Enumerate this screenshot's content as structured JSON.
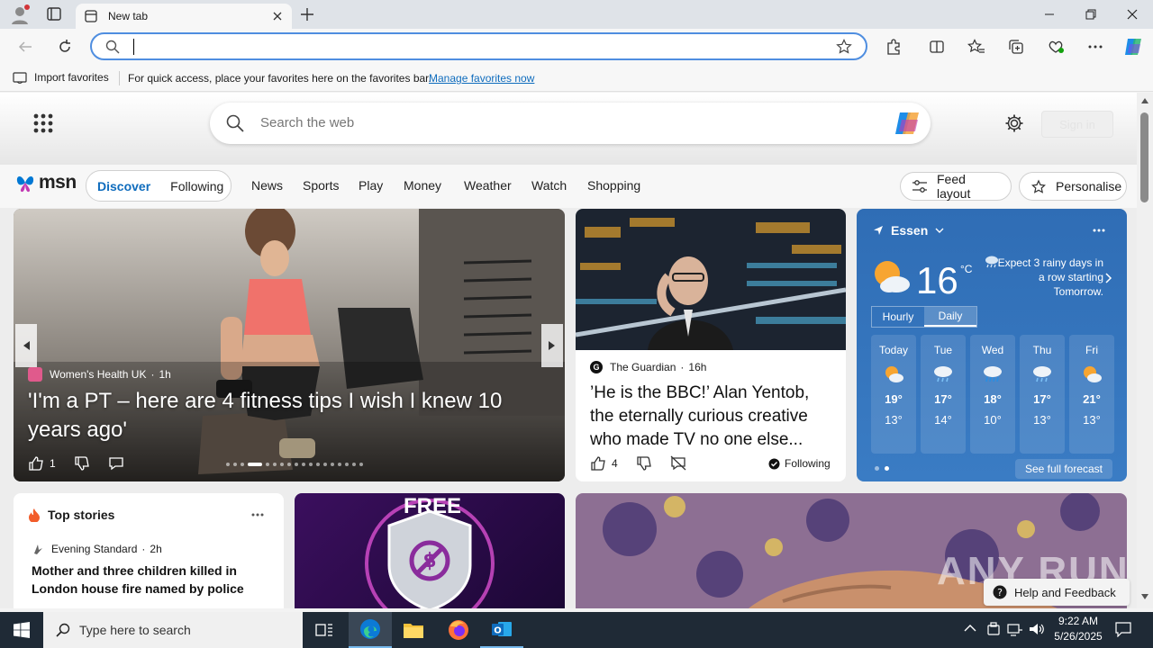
{
  "browser": {
    "tab_title": "New tab",
    "address_value": "",
    "favorites_import": "Import favorites",
    "favorites_hint": "For quick access, place your favorites here on the favorites bar.",
    "favorites_manage": "Manage favorites now"
  },
  "msn": {
    "search_placeholder": "Search the web",
    "sign_in": "Sign in",
    "logo": "msn",
    "tabs": [
      "Discover",
      "Following"
    ],
    "nav": [
      "News",
      "Sports",
      "Play",
      "Money",
      "Weather",
      "Watch",
      "Shopping"
    ],
    "feed_layout": "Feed layout",
    "personalise": "Personalise"
  },
  "hero": {
    "source": "Women's Health UK",
    "age": "1h",
    "headline": "'I'm a PT – here are 4 fitness tips I wish I knew 10 years ago'",
    "likes": "1",
    "carousel_total": 18,
    "carousel_active": 4
  },
  "guardian": {
    "source": "The Guardian",
    "age": "16h",
    "headline": "’He is the BBC!’ Alan Yentob, the eternally curious creative who made TV no one else...",
    "likes": "4",
    "following": "Following"
  },
  "weather": {
    "city": "Essen",
    "temp": "16",
    "unit": "°C",
    "alert": "Expect 3 rainy days in a row starting Tomorrow.",
    "tabs": [
      "Hourly",
      "Daily"
    ],
    "days": [
      {
        "name": "Today",
        "high": "19°",
        "low": "13°",
        "icon": "partly-sunny-icon"
      },
      {
        "name": "Tue",
        "high": "17°",
        "low": "14°",
        "icon": "cloudy-rain-icon"
      },
      {
        "name": "Wed",
        "high": "18°",
        "low": "10°",
        "icon": "rain-icon"
      },
      {
        "name": "Thu",
        "high": "17°",
        "low": "13°",
        "icon": "cloudy-rain-icon"
      },
      {
        "name": "Fri",
        "high": "21°",
        "low": "13°",
        "icon": "partly-sunny-icon"
      }
    ],
    "see_full": "See full forecast"
  },
  "top_stories": {
    "title": "Top stories",
    "source": "Evening Standard",
    "age": "2h",
    "headline": "Mother and three children killed in London house fire named by police"
  },
  "promo": {
    "label": "FREE"
  },
  "watermark": "ANY RUN",
  "help": "Help and Feedback",
  "taskbar": {
    "search_placeholder": "Type here to search",
    "time": "9:22 AM",
    "date": "5/26/2025"
  },
  "colors": {
    "accent": "#0f6cbd",
    "weather_bg": "#2f6db5",
    "taskbar": "#1f2a36"
  }
}
